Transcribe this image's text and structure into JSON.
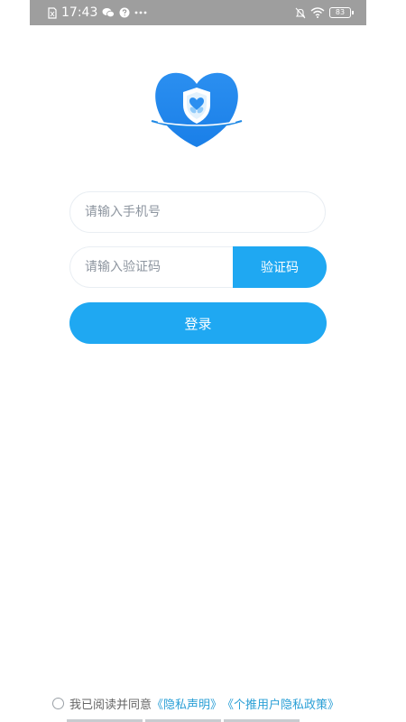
{
  "status_bar": {
    "time": "17:43",
    "battery_level": "83",
    "icons": [
      "sim-icon",
      "wechat-icon",
      "question-icon",
      "more-icon",
      "mute-icon",
      "wifi-icon",
      "battery-icon"
    ]
  },
  "logo": {
    "icon": "heart-shield-logo"
  },
  "login_form": {
    "phone_placeholder": "请输入手机号",
    "phone_value": "",
    "code_placeholder": "请输入验证码",
    "code_value": "",
    "code_button_label": "验证码",
    "login_button_label": "登录"
  },
  "agreement": {
    "checked": false,
    "text": "我已阅读并同意",
    "privacy_link": "《隐私声明》",
    "push_link": "《个推用户隐私政策》"
  },
  "colors": {
    "accent": "#1fa8f2",
    "link": "#2a9fd6",
    "status_bar": "#9e9e9e",
    "logo_blue": "#2196f3"
  }
}
